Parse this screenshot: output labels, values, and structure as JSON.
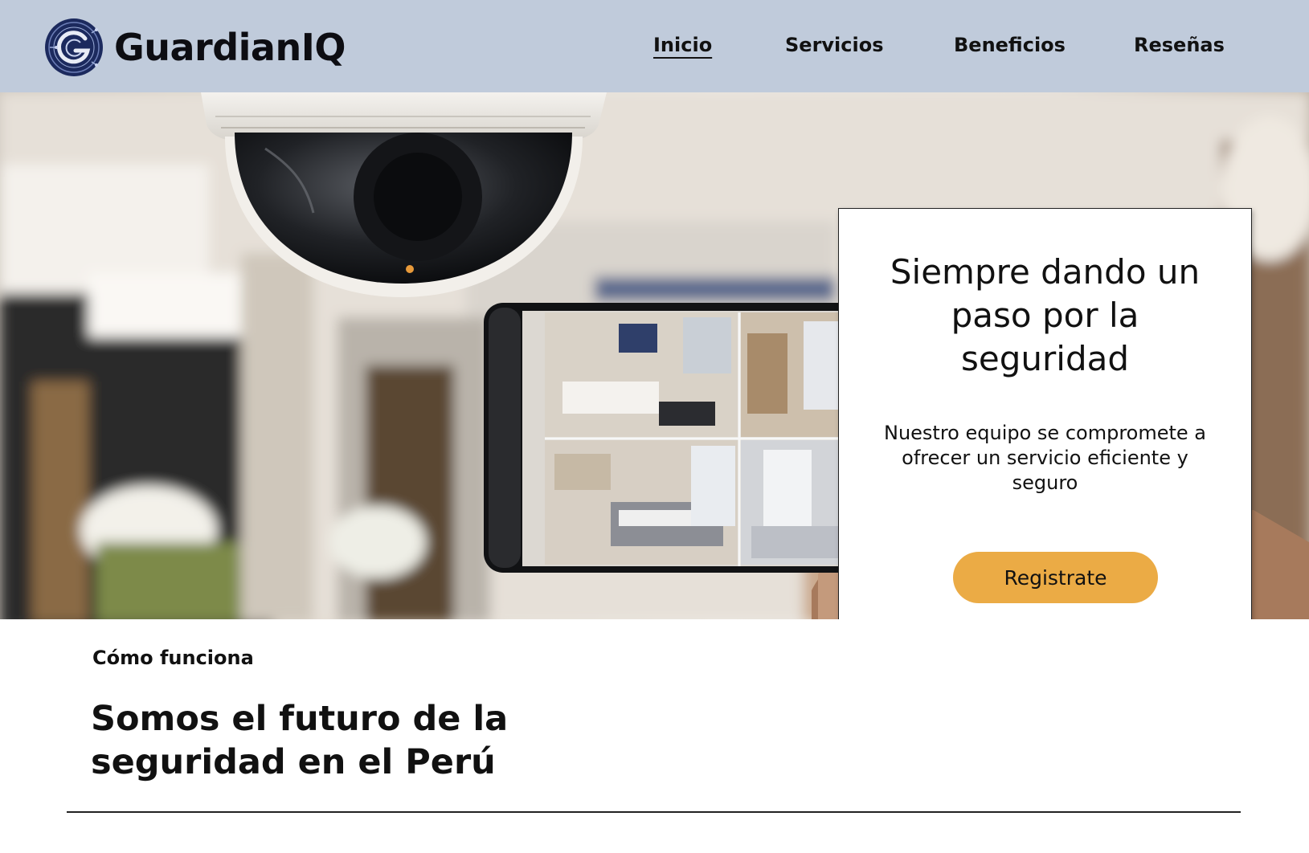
{
  "brand": {
    "name": "GuardianIQ",
    "logo_icon": "g-circuit-logo-icon"
  },
  "nav": {
    "items": [
      {
        "label": "Inicio",
        "active": true
      },
      {
        "label": "Servicios",
        "active": false
      },
      {
        "label": "Beneficios",
        "active": false
      },
      {
        "label": "Reseñas",
        "active": false
      }
    ]
  },
  "hero": {
    "image": "security-dome-camera-and-smartphone-monitoring-image",
    "card": {
      "title": "Siempre dando un paso por la seguridad",
      "text": "Nuestro equipo se compromete a ofrecer un servicio eficiente y seguro",
      "cta_label": "Registrate"
    }
  },
  "section": {
    "label": "Cómo funciona",
    "title": "Somos el futuro de la seguridad en el Perú"
  },
  "colors": {
    "header_bg": "#c0cbdb",
    "cta_bg": "#ebab45",
    "logo_navy": "#1c2a5e"
  }
}
